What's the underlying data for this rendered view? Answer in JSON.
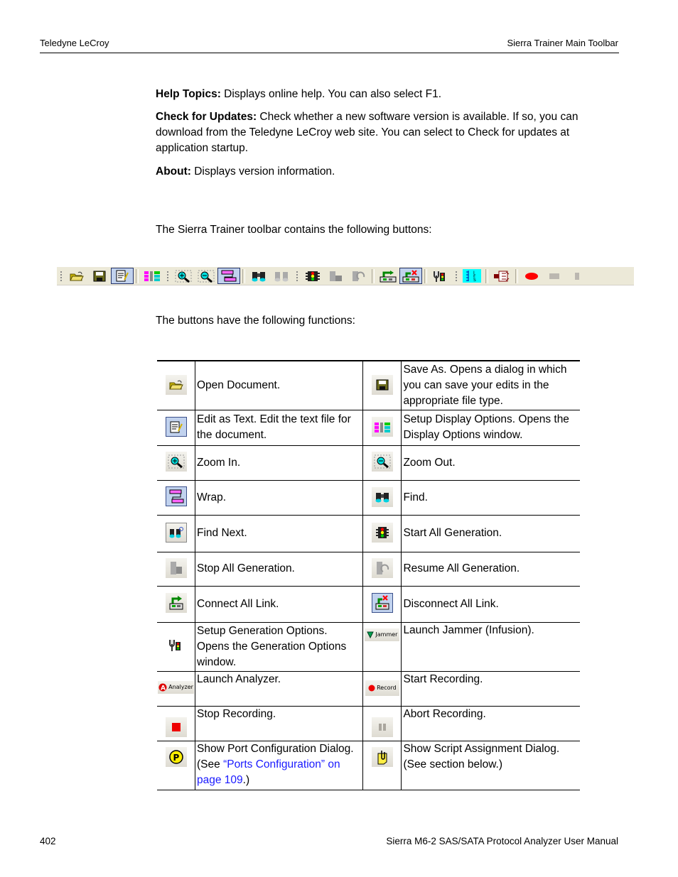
{
  "header": {
    "left": "Teledyne LeCroy",
    "right": "Sierra Trainer Main Toolbar"
  },
  "footer": {
    "page_number": "402",
    "manual_title": "Sierra M6-2 SAS/SATA Protocol Analyzer User Manual"
  },
  "help_items": [
    {
      "term": "Help Topics:",
      "desc": " Displays online help. You can also select F1."
    },
    {
      "term": "Check for Updates:",
      "desc": " Check whether a new software version is available. If so, you can download from the Teledyne LeCroy web site. You can select to Check for updates at application startup."
    },
    {
      "term": "About:",
      "desc": " Displays version information."
    }
  ],
  "intro_text": "The Sierra Trainer toolbar contains the following buttons:",
  "functions_text": "The buttons have the following functions:",
  "toolbar": {
    "buttons": [
      {
        "icon": "open-folder-icon",
        "label": "Open Document"
      },
      {
        "icon": "save-icon",
        "label": "Save As"
      },
      {
        "icon": "edit-text-icon",
        "label": "Edit as Text",
        "active": true
      },
      {
        "icon": "display-options-icon",
        "label": "Setup Display Options"
      },
      {
        "icon": "zoom-in-icon",
        "label": "Zoom In"
      },
      {
        "icon": "zoom-out-icon",
        "label": "Zoom Out"
      },
      {
        "icon": "wrap-icon",
        "label": "Wrap",
        "active": true
      },
      {
        "icon": "find-icon",
        "label": "Find"
      },
      {
        "icon": "find-next-icon",
        "label": "Find Next"
      },
      {
        "icon": "start-generation-icon",
        "label": "Start All Generation"
      },
      {
        "icon": "stop-generation-icon",
        "label": "Stop All Generation"
      },
      {
        "icon": "resume-generation-icon",
        "label": "Resume All Generation"
      },
      {
        "icon": "connect-link-icon",
        "label": "Connect All Link"
      },
      {
        "icon": "disconnect-link-icon",
        "label": "Disconnect All Link",
        "active": true
      },
      {
        "icon": "generation-options-icon",
        "label": "Setup Generation Options"
      },
      {
        "icon": "ifs-icon",
        "label": "IFS"
      },
      {
        "icon": "export-icon",
        "label": "Export"
      },
      {
        "icon": "record-icon",
        "label": "Start Recording"
      },
      {
        "icon": "stop-record-icon",
        "label": "Stop Recording"
      },
      {
        "icon": "abort-icon",
        "label": "Abort Recording"
      }
    ]
  },
  "table": {
    "rows": [
      [
        {
          "icon": "open-folder-icon",
          "text": "Open Document."
        },
        {
          "icon": "save-icon",
          "text": "Save As. Opens a dialog in which you can save your edits in the appropriate file type."
        }
      ],
      [
        {
          "icon": "edit-text-icon",
          "text": "Edit as Text. Edit the text file for the document."
        },
        {
          "icon": "display-options-icon",
          "text": "Setup Display Options. Opens the Display Options window."
        }
      ],
      [
        {
          "icon": "zoom-in-icon",
          "text": "Zoom In."
        },
        {
          "icon": "zoom-out-icon",
          "text": "Zoom Out."
        }
      ],
      [
        {
          "icon": "wrap-icon",
          "text": "Wrap."
        },
        {
          "icon": "find-icon",
          "text": "Find."
        }
      ],
      [
        {
          "icon": "find-next-icon",
          "text": "Find Next."
        },
        {
          "icon": "start-generation-icon",
          "text": "Start All Generation."
        }
      ],
      [
        {
          "icon": "stop-generation-icon",
          "text": "Stop All Generation."
        },
        {
          "icon": "resume-generation-icon",
          "text": "Resume All Generation."
        }
      ],
      [
        {
          "icon": "connect-link-icon",
          "text": "Connect All Link."
        },
        {
          "icon": "disconnect-link-icon",
          "text": "Disconnect All Link."
        }
      ],
      [
        {
          "icon": "generation-options-icon",
          "text": "Setup Generation Options. Opens the Generation Options window."
        },
        {
          "icon": "jammer-icon",
          "icon_label": "Jammer",
          "text": "Launch Jammer (Infusion)."
        }
      ],
      [
        {
          "icon": "analyzer-icon",
          "icon_label": "Analyzer",
          "text": "Launch Analyzer."
        },
        {
          "icon": "record-icon",
          "icon_label": "Record",
          "text": "Start Recording."
        }
      ],
      [
        {
          "icon": "stop-record-icon",
          "text": "Stop Recording."
        },
        {
          "icon": "abort-icon",
          "text": "Abort Recording."
        }
      ],
      [
        {
          "icon": "port-config-icon",
          "text_before": "Show Port Configuration Dialog. (See ",
          "link": "“Ports Configuration” on page 109",
          "text_after": ".)"
        },
        {
          "icon": "script-assignment-icon",
          "text": "Show Script Assignment Dialog.",
          "text2": "(See section below.)"
        }
      ]
    ]
  },
  "colors": {
    "link": "#1a1aff",
    "toolbar_bg": "#ece9d8",
    "active_button_bg": "#c1d2ee",
    "active_button_border": "#25346a"
  }
}
